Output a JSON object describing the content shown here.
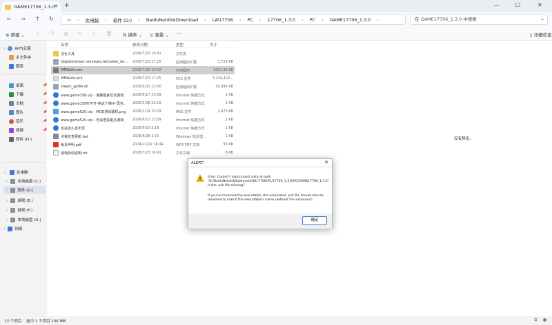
{
  "window": {
    "tab_title": "GAME17706_1.3.0",
    "new_tab": "+",
    "minimize": "—",
    "maximize": "☐",
    "close": "✕"
  },
  "address": {
    "crumbs": [
      "此电脑",
      "软件 (D:)",
      "BaiduNetdiskDownload",
      "LW17706",
      "PC",
      "17706_1.3.0",
      "PC",
      "GAME17706_1.3.0"
    ],
    "search_placeholder": "在 GAME17706_1.3.0 中搜索"
  },
  "commands": {
    "new": "新建",
    "sort": "排序",
    "view": "查看",
    "more": "···",
    "details": "详细信息"
  },
  "columns": {
    "name": "名称",
    "date": "修改日期",
    "type": "类型",
    "size": "大小"
  },
  "sidebar": {
    "quick": [
      {
        "label": "WPS云盘",
        "color": "#4a8fe0",
        "chev": "›"
      },
      {
        "label": "主文件夹",
        "color": "#e2a13b",
        "chev": ""
      },
      {
        "label": "图库",
        "color": "#3a7bd5",
        "chev": ""
      }
    ],
    "pinned": [
      {
        "label": "桌面",
        "color": "#4a90d9"
      },
      {
        "label": "下载",
        "color": "#2f8a4a"
      },
      {
        "label": "文档",
        "color": "#6b7fa3"
      },
      {
        "label": "图片",
        "color": "#3d8fd1"
      },
      {
        "label": "音乐",
        "color": "#e0533b"
      },
      {
        "label": "视频",
        "color": "#8b4ad9"
      },
      {
        "label": "软件 (D:)",
        "color": "#666666"
      }
    ],
    "computer": {
      "label": "此电脑",
      "color": "#3a7bd5"
    },
    "drives": [
      {
        "label": "本地磁盘 (C:)"
      },
      {
        "label": "软件 (D:)"
      },
      {
        "label": "游戏 (E:)"
      },
      {
        "label": "游戏 (F:)"
      },
      {
        "label": "本地磁盘 (G:)"
      }
    ],
    "network": {
      "label": "网络",
      "color": "#3a7bd5"
    }
  },
  "files": [
    {
      "name": "汉化工具",
      "date": "2026/7/23 18:41",
      "type": "文件夹",
      "size": "",
      "icon_color": "#f3c34a"
    },
    {
      "name": "libgodotsteam.windows.template_rel...",
      "date": "2026/7/23 17:25",
      "type": "应用程序扩展",
      "size": "3,729 KB",
      "icon_color": "#9aa5b1"
    },
    {
      "name": "MMALife.exe",
      "date": "2026/7/28 10:50",
      "type": "应用程序",
      "size": "109,140 KB",
      "icon_color": "#7a7a7a"
    },
    {
      "name": "MMALife.pck",
      "date": "2026/7/23 17:25",
      "type": "PCK 文件",
      "size": "3,234,422...",
      "icon_color": "#dddddd"
    },
    {
      "name": "steam_api64.dll",
      "date": "2026/5/31 13:00",
      "type": "应用程序扩展",
      "size": "10,990 KB",
      "icon_color": "#9aa5b1"
    },
    {
      "name": "www.game158.vip - 海量健身互动游戏",
      "date": "2026/6/17 23:09",
      "type": "Internet 快捷方式",
      "size": "1 KB",
      "icon_color": "#2b7bd6"
    },
    {
      "name": "www.game158打不开-用这个梯子-再也...",
      "date": "2025/5/28 23:15",
      "type": "Internet 快捷方式",
      "size": "1 KB",
      "icon_color": "#2b7bd6"
    },
    {
      "name": "www.game520.vip - MOD游戏联机.png",
      "date": "2025/11/4 15:29",
      "type": "PNG 文件",
      "size": "1,473 KB",
      "icon_color": "#4aa3df"
    },
    {
      "name": "www.game520.vip - 无毒查看更多游戏",
      "date": "2026/6/17 23:09",
      "type": "Internet 快捷方式",
      "size": "1 KB",
      "icon_color": "#2b7bd6"
    },
    {
      "name": "本站永久发布页",
      "date": "2025/8/10 2:16",
      "type": "Internet 快捷方式",
      "size": "1 KB",
      "icon_color": "#2b7bd6"
    },
    {
      "name": "点我检查更新.bat",
      "date": "2026/6/28 2:15",
      "type": "Windows 批处理...",
      "size": "1 KB",
      "icon_color": "#8a8a8a"
    },
    {
      "name": "免责声明.pdf",
      "date": "2024/12/22 16:44",
      "type": "WPS PDF 文档",
      "size": "93 KB",
      "icon_color": "#d9342b"
    },
    {
      "name": "游戏启动说明.txt",
      "date": "2026/7/23 18:41",
      "type": "文本文档",
      "size": "6 KB",
      "icon_color": "#e8e8e8"
    }
  ],
  "preview_note": "没有预览。",
  "status": {
    "count": "13 个项目",
    "selected": "选中 1 个项目  106 MB"
  },
  "dialog": {
    "title": "ALERT!",
    "close": "✕",
    "message1": "Error: Couldn't load project data at path \"D:/BaiduNetdiskDownload/LW17706/PC/17706_1.3.0/PC/GAME17706_1.3.0\". Is the .pck file missing?",
    "message2": "If you've renamed the executable, the associated .pck file should also be renamed to match the executable's name (without the extension).",
    "ok": "确定"
  },
  "colors": {
    "accent": "#3b7fd2",
    "warning": "#f2b807",
    "folder": "#f3c34a"
  }
}
